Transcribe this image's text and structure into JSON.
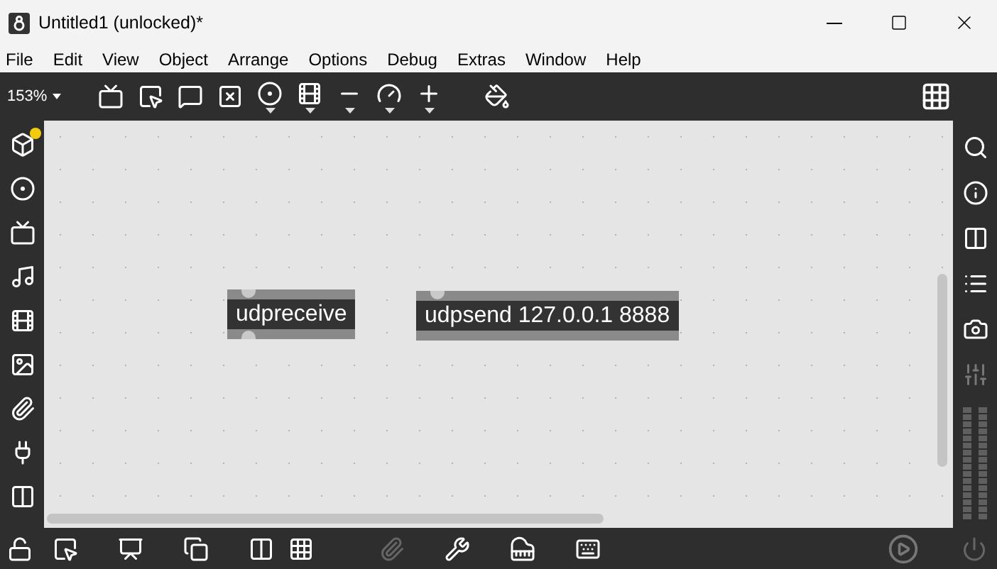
{
  "window": {
    "title": "Untitled1 (unlocked)*"
  },
  "menu": [
    "File",
    "Edit",
    "View",
    "Object",
    "Arrange",
    "Options",
    "Debug",
    "Extras",
    "Window",
    "Help"
  ],
  "toolbar": {
    "zoom": "153%"
  },
  "objects": [
    {
      "text": "udpreceive",
      "has_outlet": true
    },
    {
      "text": "udpsend 127.0.0.1 8888",
      "has_outlet": false
    }
  ]
}
